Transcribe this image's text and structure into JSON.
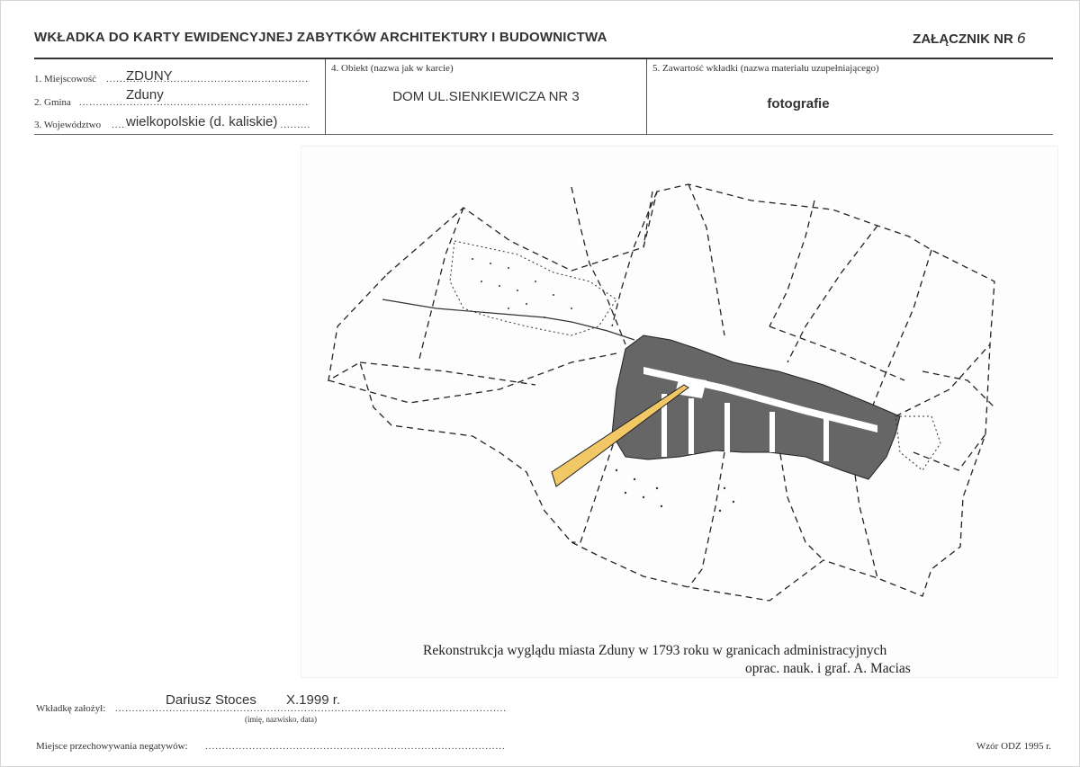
{
  "header": {
    "title": "WKŁADKA DO KARTY EWIDENCYJNEJ ZABYTKÓW ARCHITEKTURY I BUDOWNICTWA",
    "annex_label": "ZAŁĄCZNIK NR",
    "annex_number": "6"
  },
  "fields": {
    "locality": {
      "label": "1. Miejscowość",
      "value": "ZDUNY"
    },
    "commune": {
      "label": "2. Gmina",
      "value": "Zduny"
    },
    "voivodeship": {
      "label": "3. Województwo",
      "value": "wielkopolskie (d. kaliskie)"
    },
    "object": {
      "label": "4. Obiekt (nazwa jak w karcie)",
      "value": "DOM UL.SIENKIEWICZA NR 3"
    },
    "contents": {
      "label": "5. Zawartość wkładki (nazwa materiału uzupełniającego)",
      "value": "fotografie"
    }
  },
  "map": {
    "caption_line1": "Rekonstrukcja wyglądu miasta Zduny w 1793 roku w granicach administracyjnych",
    "caption_line2": "oprac. nauk. i graf.  A. Macias",
    "accent_color": "#f2c766"
  },
  "footer": {
    "founder_label": "Wkładkę założył:",
    "founder_value": "Dariusz Stoces",
    "founder_date": "X.1999 r.",
    "founder_hint": "(imię, nazwisko, data)",
    "negatives_label": "Miejsce przechowywania negatywów:",
    "form_version": "Wzór ODZ 1995 r."
  }
}
